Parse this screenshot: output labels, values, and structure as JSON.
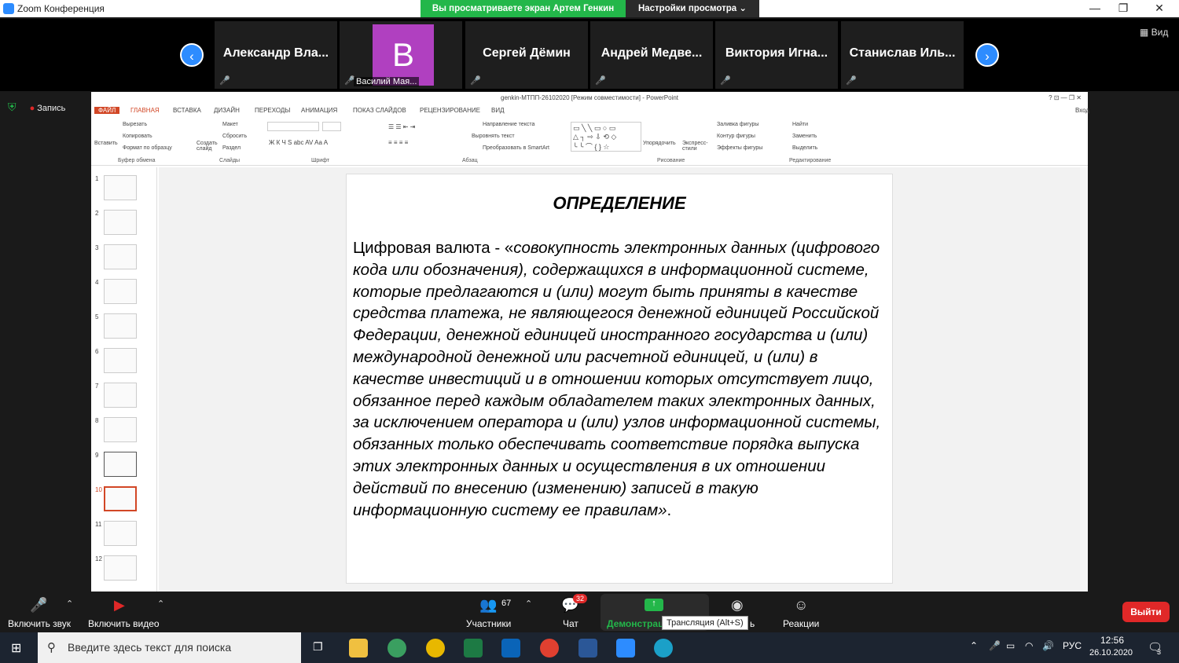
{
  "window": {
    "title": "Zoom Конференция"
  },
  "banner": {
    "sharing": "Вы просматриваете экран Артем Генкин",
    "view_options": "Настройки просмотра ⌄"
  },
  "gallery": {
    "participants": [
      "Александр Вла...",
      "Василий Мая...",
      "Сергей Дёмин",
      "Андрей Медве...",
      "Виктория Игна...",
      "Станислав Иль..."
    ],
    "avatar_letter": "B",
    "view_label": "Вид"
  },
  "recording": {
    "label": "Запись"
  },
  "powerpoint": {
    "title": "genkin-МТПП-26102020 [Режим совместимости] - PowerPoint",
    "tabs": [
      "ФАЙЛ",
      "ГЛАВНАЯ",
      "ВСТАВКА",
      "ДИЗАЙН",
      "ПЕРЕХОДЫ",
      "АНИМАЦИЯ",
      "ПОКАЗ СЛАЙДОВ",
      "РЕЦЕНЗИРОВАНИЕ",
      "ВИД"
    ],
    "signin": "Вход",
    "ribbon_groups": [
      "Буфер обмена",
      "Слайды",
      "Шрифт",
      "Абзац",
      "Рисование",
      "Редактирование"
    ],
    "ribbon_items": {
      "paste": "Вставить",
      "cut": "Вырезать",
      "copy": "Копировать",
      "format_painter": "Формат по образцу",
      "new_slide": "Создать слайд",
      "layout": "Макет",
      "reset": "Сбросить",
      "section": "Раздел",
      "text_direction": "Направление текста",
      "align_text": "Выровнять текст",
      "smartart": "Преобразовать в SmartArt",
      "arrange": "Упорядочить",
      "quick_styles": "Экспресс-стили",
      "shape_fill": "Заливка фигуры",
      "shape_outline": "Контур фигуры",
      "shape_effects": "Эффекты фигуры",
      "find": "Найти",
      "replace": "Заменить",
      "select": "Выделить"
    },
    "slide_numbers": [
      "1",
      "2",
      "3",
      "4",
      "5",
      "6",
      "7",
      "8",
      "9",
      "10",
      "11",
      "12"
    ],
    "slide": {
      "heading": "ОПРЕДЕЛЕНИЕ",
      "lead": "Цифровая валюта - «",
      "body": "совокупность электронных данных (цифрового кода или обозначения), содержащихся в информационной системе, которые предлагаются и (или) могут быть приняты в качестве средства платежа, не являющегося денежной единицей Российской Федерации, денежной единицей иностранного государства и (или) международной денежной или расчетной единицей, и (или) в качестве инвестиций и в отношении которых отсутствует лицо, обязанное перед каждым обладателем таких электронных данных, за исключением оператора и (или) узлов информационной системы, обязанных только обеспечивать соответствие порядка выпуска этих электронных данных и осуществления в их отношении действий по внесению (изменению) записей в такую информационную систему ее правилам»",
      "end": "."
    }
  },
  "toolbar": {
    "audio": "Включить звук",
    "video": "Включить видео",
    "participants": "Участники",
    "participants_count": "67",
    "chat": "Чат",
    "chat_badge": "32",
    "share": "Демонстрац",
    "record": "ь",
    "reactions": "Реакции",
    "tooltip": "Трансляция (Alt+S)",
    "exit": "Выйти"
  },
  "taskbar": {
    "search_placeholder": "Введите здесь текст для поиска",
    "lang": "РУС",
    "time": "12:56",
    "date": "26.10.2020",
    "notif": "3"
  }
}
